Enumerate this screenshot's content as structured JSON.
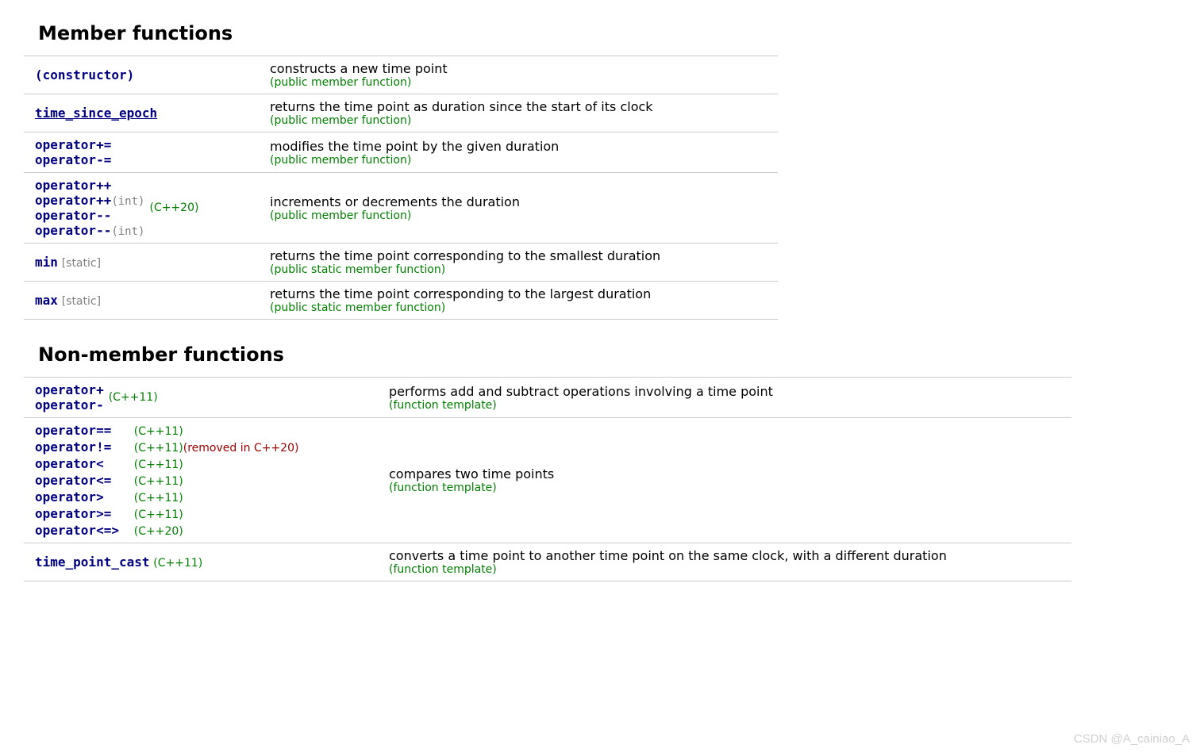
{
  "member_functions": {
    "heading": "Member functions",
    "rows": {
      "constructor": {
        "name": "(constructor)",
        "desc": "constructs a new time point",
        "kind": "(public member function)"
      },
      "time_since_epoch": {
        "name": "time_since_epoch",
        "desc": "returns the time point as duration since the start of its clock",
        "kind": "(public member function)"
      },
      "compound_assign": {
        "op_plus_eq": "operator+=",
        "op_minus_eq": "operator-=",
        "desc": "modifies the time point by the given duration",
        "kind": "(public member function)"
      },
      "inc_dec": {
        "op_pp": "operator++",
        "op_pp_int": "operator++",
        "op_pp_int_suffix": "(int)",
        "op_mm": "operator--",
        "op_mm_int": "operator--",
        "op_mm_int_suffix": "(int)",
        "version": "(C++20)",
        "desc": "increments or decrements the duration",
        "kind": "(public member function)"
      },
      "min": {
        "name": "min",
        "tag": "[static]",
        "desc": "returns the time point corresponding to the smallest duration",
        "kind": "(public static member function)"
      },
      "max": {
        "name": "max",
        "tag": "[static]",
        "desc": "returns the time point corresponding to the largest duration",
        "kind": "(public static member function)"
      }
    }
  },
  "nonmember_functions": {
    "heading": "Non-member functions",
    "rows": {
      "add_sub": {
        "op_plus": "operator+",
        "op_minus": "operator-",
        "version": "(C++11)",
        "desc": "performs add and subtract operations involving a time point",
        "kind": "(function template)"
      },
      "compare": {
        "op_eq": "operator==",
        "op_eq_v": "(C++11)",
        "op_ne": "operator!=",
        "op_ne_v": "(C++11)",
        "op_ne_removed": "(removed in C++20)",
        "op_lt": "operator<",
        "op_lt_v": "(C++11)",
        "op_le": "operator<=",
        "op_le_v": "(C++11)",
        "op_gt": "operator>",
        "op_gt_v": "(C++11)",
        "op_ge": "operator>=",
        "op_ge_v": "(C++11)",
        "op_spc": "operator<=>",
        "op_spc_v": "(C++20)",
        "desc": "compares two time points",
        "kind": "(function template)"
      },
      "time_point_cast": {
        "name": "time_point_cast",
        "version": "(C++11)",
        "desc": "converts a time point to another time point on the same clock, with a different duration",
        "kind": "(function template)"
      }
    }
  },
  "watermark": "CSDN @A_cainiao_A"
}
